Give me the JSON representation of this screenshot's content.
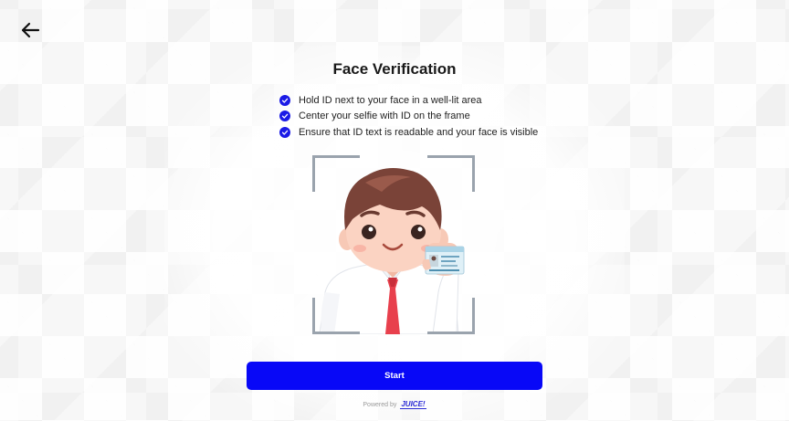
{
  "header": {
    "back_icon": "arrow-left-icon"
  },
  "page": {
    "title": "Face Verification"
  },
  "instructions": [
    {
      "icon": "check-circle-icon",
      "text": "Hold ID next to your face in a well-lit area"
    },
    {
      "icon": "check-circle-icon",
      "text": "Center your selfie with ID on the frame"
    },
    {
      "icon": "check-circle-icon",
      "text": "Ensure that ID text is readable and your face is visible"
    }
  ],
  "actions": {
    "start_label": "Start"
  },
  "footer": {
    "powered_label": "Powered by",
    "brand_name": "JUICE!"
  },
  "colors": {
    "primary": "#0808f7",
    "check": "#1b1be6",
    "frame": "#9aa3ad"
  }
}
